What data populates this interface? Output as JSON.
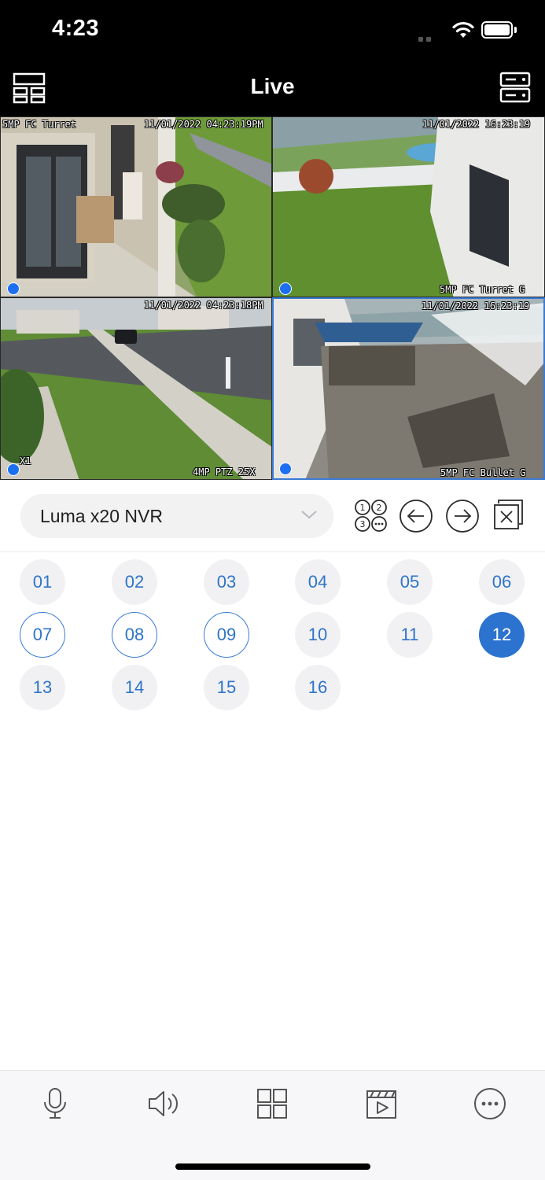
{
  "status_bar": {
    "time": "4:23"
  },
  "nav": {
    "title": "Live",
    "left_icon": "layout-icon",
    "right_icon": "device-list-icon"
  },
  "cameras": [
    {
      "name": "5MP FC Turret",
      "timestamp": "11/01/2022 04:23:19PM"
    },
    {
      "name": "5MP FC Turret G",
      "timestamp": "11/01/2022 16:23:19"
    },
    {
      "name": "4MP PTZ 25X",
      "timestamp": "11/01/2022 04:23:18PM",
      "zoom": "X1"
    },
    {
      "name": "5MP FC Bullet G",
      "timestamp": "11/01/2022 16:23:19"
    }
  ],
  "device": {
    "name": "Luma x20 NVR"
  },
  "channels": [
    "01",
    "02",
    "03",
    "04",
    "05",
    "06",
    "07",
    "08",
    "09",
    "10",
    "11",
    "12",
    "13",
    "14",
    "15",
    "16"
  ],
  "channel_states": {
    "outlined": [
      "07",
      "08",
      "09"
    ],
    "active": "12"
  },
  "toolbar": [
    "microphone-icon",
    "speaker-icon",
    "grid-view-icon",
    "playback-icon",
    "more-icon"
  ],
  "colors": {
    "accent": "#2c72cf",
    "header": "#000000",
    "channel_bg": "#f1f1f3"
  }
}
